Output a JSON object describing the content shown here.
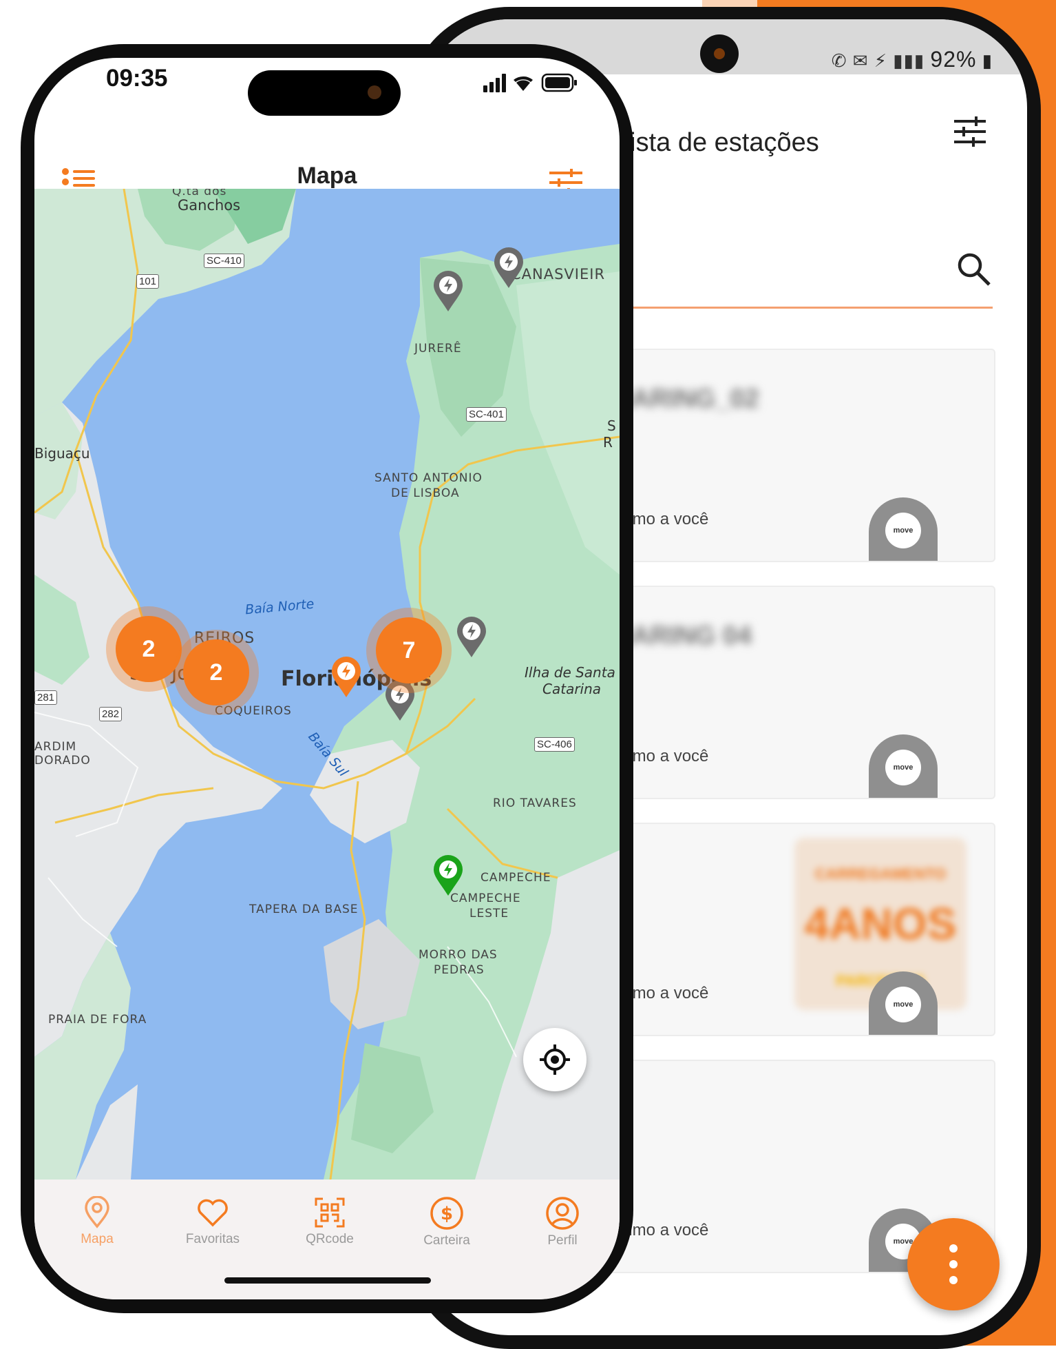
{
  "android": {
    "status_text": "92%",
    "title": "Lista de estações",
    "cards": [
      {
        "name": "SHARING_02",
        "distance_label": "Próximo a você",
        "logo": "move"
      },
      {
        "name": "SHARING 04",
        "distance_label": "Próximo a você",
        "logo": "move"
      },
      {
        "name": "",
        "distance_label": "Próximo a você",
        "logo": "move",
        "promo": [
          "CARREGAMENTO",
          "4ANOS",
          "PARCEIROS"
        ]
      },
      {
        "name": "",
        "distance_label": "Próximo a você",
        "logo": "move"
      }
    ],
    "fab_icon": "more-vertical-icon"
  },
  "ios": {
    "time": "09:35",
    "nav_title": "Mapa",
    "left_icon": "list-icon",
    "right_icon": "filter-sliders-icon",
    "map_labels": {
      "ganchos": "Ganchos",
      "qta": "Q.ta dos",
      "biguacu": "Biguaçu",
      "canasvieiras": "CANASVIEIR",
      "jurere": "JURERÊ",
      "santo_antonio": "SANTO ANTONIO",
      "de_lisboa": "DE LISBOA",
      "baia_norte": "Baía Norte",
      "baia_sul": "Baía Sul",
      "barreiros": "REIROS",
      "sao_jose": "São Jo",
      "florianopolis": "Florianópolis",
      "coqueiros": "COQUEIROS",
      "ilha": "Ilha de Santa",
      "catarina": "Catarina",
      "rio_tavares": "RIO TAVARES",
      "campeche": "CAMPECHE",
      "campeche_leste": "CAMPECHE",
      "leste": "LESTE",
      "tapera": "TAPERA DA BASE",
      "morro": "MORRO DAS",
      "pedras": "PEDRAS",
      "praia_fora": "PRAIA DE FORA",
      "jardim": "ARDIM",
      "dorado": "DORADO",
      "s_r": "S",
      "r": "R"
    },
    "road_shields": {
      "sc410": "SC-410",
      "br101": "101",
      "sc401": "SC-401",
      "br282": "282",
      "br281": "281",
      "sc406": "SC-406"
    },
    "clusters": [
      {
        "count": "2",
        "color": "#f47b20"
      },
      {
        "count": "2",
        "color": "#f47b20"
      },
      {
        "count": "7",
        "color": "#f47b20"
      }
    ],
    "tabs": [
      {
        "label": "Mapa",
        "icon": "map-pin-icon",
        "active": true
      },
      {
        "label": "Favoritas",
        "icon": "heart-icon",
        "active": false
      },
      {
        "label": "QRcode",
        "icon": "qrcode-icon",
        "active": false
      },
      {
        "label": "Carteira",
        "icon": "dollar-icon",
        "active": false
      },
      {
        "label": "Perfil",
        "icon": "profile-icon",
        "active": false
      }
    ]
  },
  "colors": {
    "accent": "#f47b20",
    "pin_grey": "#6b6b6b",
    "pin_green": "#1aa31a"
  }
}
